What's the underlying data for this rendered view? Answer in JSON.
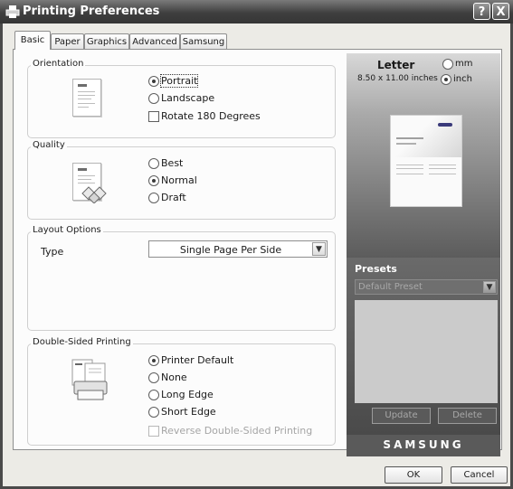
{
  "window": {
    "title": "Printing Preferences",
    "help_label": "?",
    "close_label": "X"
  },
  "tabs": [
    {
      "label": "Basic"
    },
    {
      "label": "Paper"
    },
    {
      "label": "Graphics"
    },
    {
      "label": "Advanced"
    },
    {
      "label": "Samsung"
    }
  ],
  "orientation": {
    "group_label": "Orientation",
    "options": [
      {
        "label": "Portrait",
        "selected": true
      },
      {
        "label": "Landscape",
        "selected": false
      }
    ],
    "rotate_label": "Rotate 180 Degrees",
    "rotate_checked": false
  },
  "quality": {
    "group_label": "Quality",
    "options": [
      {
        "label": "Best",
        "selected": false
      },
      {
        "label": "Normal",
        "selected": true
      },
      {
        "label": "Draft",
        "selected": false
      }
    ]
  },
  "layout": {
    "group_label": "Layout Options",
    "type_label": "Type",
    "type_value": "Single Page Per Side"
  },
  "duplex": {
    "group_label": "Double-Sided Printing",
    "options": [
      {
        "label": "Printer Default",
        "selected": true
      },
      {
        "label": "None",
        "selected": false
      },
      {
        "label": "Long Edge",
        "selected": false
      },
      {
        "label": "Short Edge",
        "selected": false
      }
    ],
    "reverse_label": "Reverse Double-Sided Printing",
    "reverse_enabled": false
  },
  "preview": {
    "paper_name": "Letter",
    "paper_size": "8.50 x 11.00 inches",
    "unit_mm": "mm",
    "unit_inch": "inch",
    "selected_unit": "inch"
  },
  "presets": {
    "title": "Presets",
    "value": "Default Preset",
    "update_label": "Update",
    "delete_label": "Delete"
  },
  "brand": "SAMSUNG",
  "buttons": {
    "ok": "OK",
    "cancel": "Cancel"
  },
  "colors": {
    "title_bar": "#3f3f3f",
    "panel_dark": "#5a5a5a",
    "window_bg": "#ecebe6"
  }
}
